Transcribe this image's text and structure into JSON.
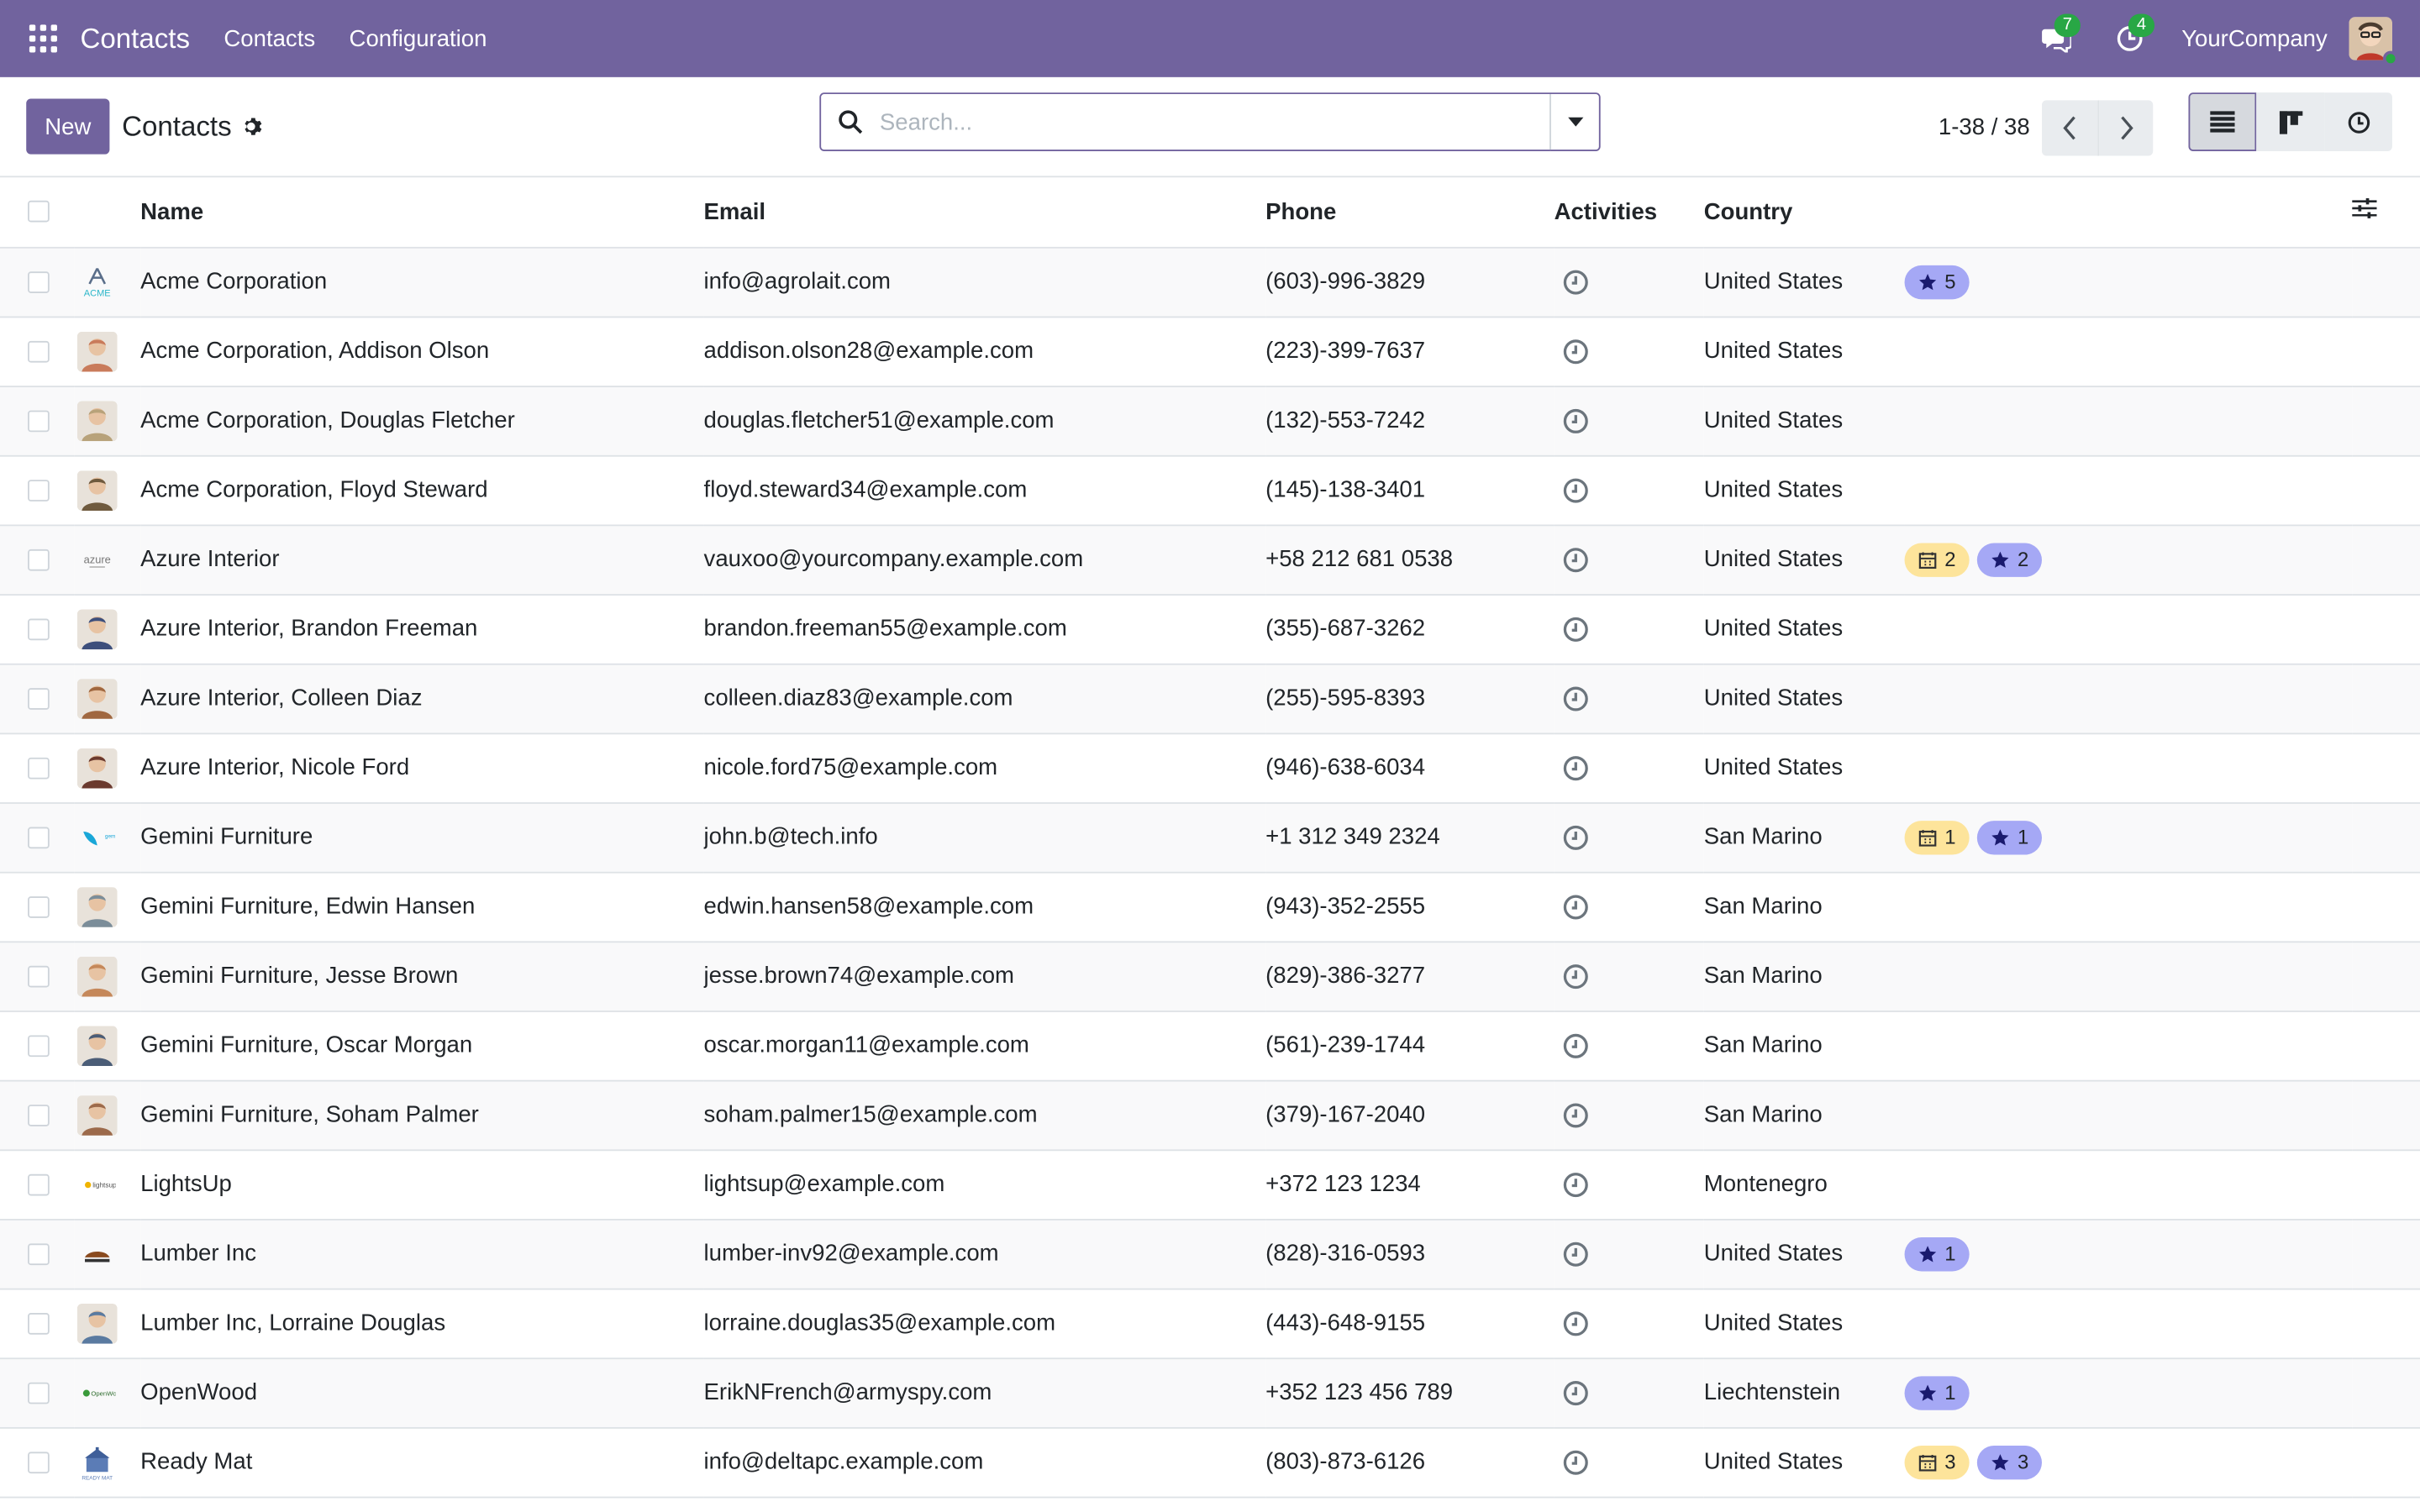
{
  "nav": {
    "brand": "Contacts",
    "menus": [
      "Contacts",
      "Configuration"
    ],
    "messages_badge": "7",
    "activities_badge": "4",
    "company": "YourCompany"
  },
  "control": {
    "new_label": "New",
    "breadcrumb": "Contacts",
    "search_placeholder": "Search...",
    "pager": "1-38 / 38"
  },
  "table": {
    "headers": [
      "Name",
      "Email",
      "Phone",
      "Activities",
      "Country"
    ],
    "rows": [
      {
        "name": "Acme Corporation",
        "email": "info@agrolait.com",
        "phone": "(603)-996-3829",
        "country": "United States",
        "tags": [
          {
            "kind": "star",
            "count": "5"
          }
        ],
        "thumb": "acme"
      },
      {
        "name": "Acme Corporation, Addison Olson",
        "email": "addison.olson28@example.com",
        "phone": "(223)-399-7637",
        "country": "United States",
        "tags": [],
        "thumb": "person"
      },
      {
        "name": "Acme Corporation, Douglas Fletcher",
        "email": "douglas.fletcher51@example.com",
        "phone": "(132)-553-7242",
        "country": "United States",
        "tags": [],
        "thumb": "person"
      },
      {
        "name": "Acme Corporation, Floyd Steward",
        "email": "floyd.steward34@example.com",
        "phone": "(145)-138-3401",
        "country": "United States",
        "tags": [],
        "thumb": "person"
      },
      {
        "name": "Azure Interior",
        "email": "vauxoo@yourcompany.example.com",
        "phone": "+58 212 681 0538",
        "country": "United States",
        "tags": [
          {
            "kind": "cal",
            "count": "2"
          },
          {
            "kind": "star",
            "count": "2"
          }
        ],
        "thumb": "azure"
      },
      {
        "name": "Azure Interior, Brandon Freeman",
        "email": "brandon.freeman55@example.com",
        "phone": "(355)-687-3262",
        "country": "United States",
        "tags": [],
        "thumb": "person"
      },
      {
        "name": "Azure Interior, Colleen Diaz",
        "email": "colleen.diaz83@example.com",
        "phone": "(255)-595-8393",
        "country": "United States",
        "tags": [],
        "thumb": "person"
      },
      {
        "name": "Azure Interior, Nicole Ford",
        "email": "nicole.ford75@example.com",
        "phone": "(946)-638-6034",
        "country": "United States",
        "tags": [],
        "thumb": "person"
      },
      {
        "name": "Gemini Furniture",
        "email": "john.b@tech.info",
        "phone": "+1 312 349 2324",
        "country": "San Marino",
        "tags": [
          {
            "kind": "cal",
            "count": "1"
          },
          {
            "kind": "star",
            "count": "1"
          }
        ],
        "thumb": "gemini"
      },
      {
        "name": "Gemini Furniture, Edwin Hansen",
        "email": "edwin.hansen58@example.com",
        "phone": "(943)-352-2555",
        "country": "San Marino",
        "tags": [],
        "thumb": "person"
      },
      {
        "name": "Gemini Furniture, Jesse Brown",
        "email": "jesse.brown74@example.com",
        "phone": "(829)-386-3277",
        "country": "San Marino",
        "tags": [],
        "thumb": "person"
      },
      {
        "name": "Gemini Furniture, Oscar Morgan",
        "email": "oscar.morgan11@example.com",
        "phone": "(561)-239-1744",
        "country": "San Marino",
        "tags": [],
        "thumb": "person"
      },
      {
        "name": "Gemini Furniture, Soham Palmer",
        "email": "soham.palmer15@example.com",
        "phone": "(379)-167-2040",
        "country": "San Marino",
        "tags": [],
        "thumb": "person"
      },
      {
        "name": "LightsUp",
        "email": "lightsup@example.com",
        "phone": "+372 123 1234",
        "country": "Montenegro",
        "tags": [],
        "thumb": "lightsup"
      },
      {
        "name": "Lumber Inc",
        "email": "lumber-inv92@example.com",
        "phone": "(828)-316-0593",
        "country": "United States",
        "tags": [
          {
            "kind": "star",
            "count": "1"
          }
        ],
        "thumb": "lumber"
      },
      {
        "name": "Lumber Inc, Lorraine Douglas",
        "email": "lorraine.douglas35@example.com",
        "phone": "(443)-648-9155",
        "country": "United States",
        "tags": [],
        "thumb": "person"
      },
      {
        "name": "OpenWood",
        "email": "ErikNFrench@armyspy.com",
        "phone": "+352 123 456 789",
        "country": "Liechtenstein",
        "tags": [
          {
            "kind": "star",
            "count": "1"
          }
        ],
        "thumb": "openwood"
      },
      {
        "name": "Ready Mat",
        "email": "info@deltapc.example.com",
        "phone": "(803)-873-6126",
        "country": "United States",
        "tags": [
          {
            "kind": "cal",
            "count": "3"
          },
          {
            "kind": "star",
            "count": "3"
          }
        ],
        "thumb": "readymat"
      }
    ]
  },
  "colors": {
    "brand": "#71639e",
    "badge": "#28a745",
    "star_tag": "#a5a8f5",
    "cal_tag": "#fde49b"
  },
  "icons": {
    "apps": "apps-grid-icon",
    "messages": "chat-icon",
    "activities": "clock-icon",
    "search": "search-icon",
    "settings": "gear-icon",
    "list_view": "list-view-icon",
    "kanban_view": "kanban-view-icon",
    "activity_view": "activity-view-icon"
  }
}
